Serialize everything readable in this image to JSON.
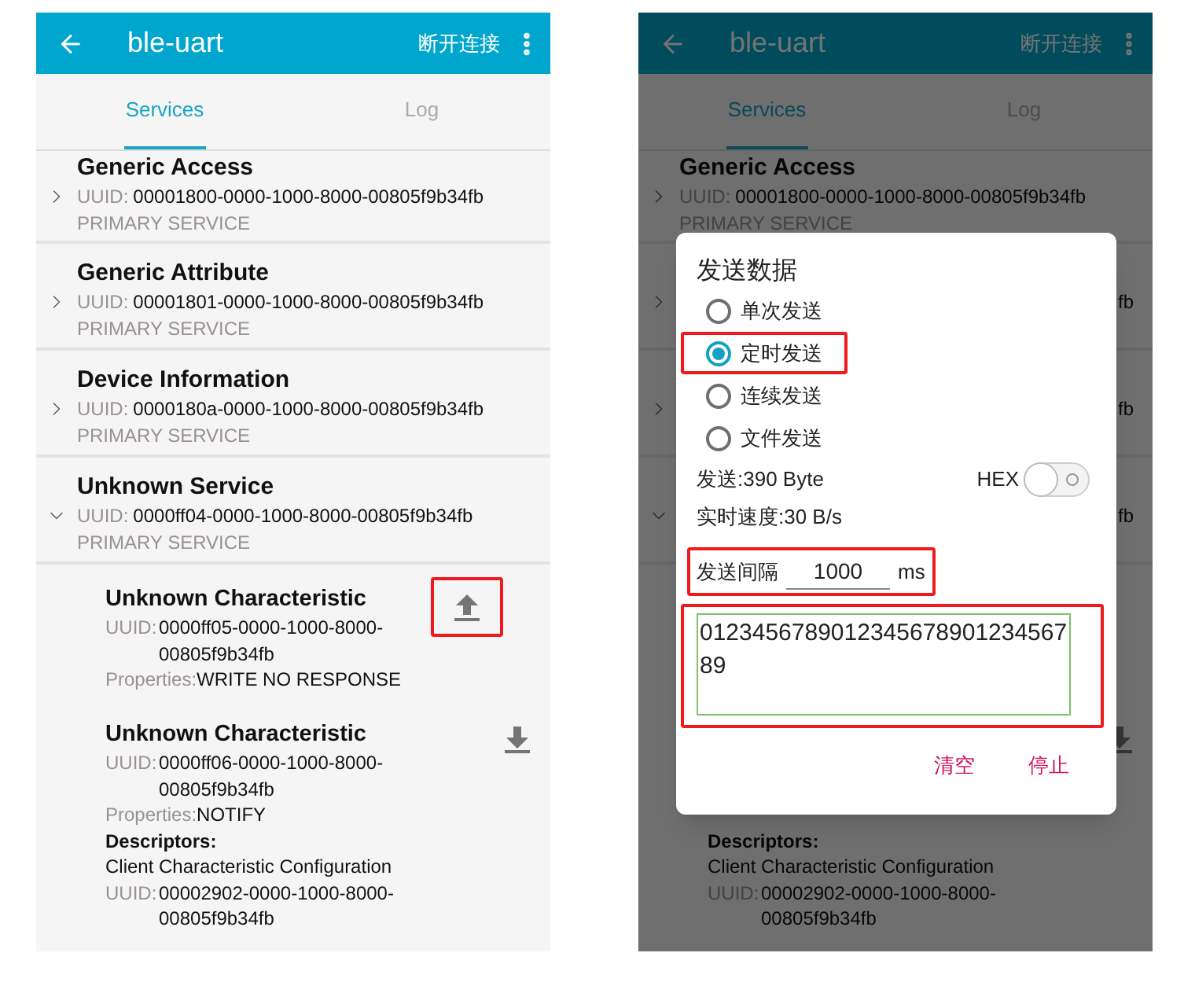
{
  "screens": [
    {
      "kind": "plain",
      "header": {
        "title": "ble-uart",
        "action": "断开连接"
      },
      "tabs": [
        {
          "label": "Services",
          "selected": true
        },
        {
          "label": "Log",
          "selected": false
        }
      ],
      "services": [
        {
          "name": "Generic Access",
          "uuid_label": "UUID:",
          "uuid": "00001800-0000-1000-8000-00805f9b34fb",
          "type": "PRIMARY SERVICE",
          "expanded": false
        },
        {
          "name": "Generic Attribute",
          "uuid_label": "UUID:",
          "uuid": "00001801-0000-1000-8000-00805f9b34fb",
          "type": "PRIMARY SERVICE",
          "expanded": false
        },
        {
          "name": "Device Information",
          "uuid_label": "UUID:",
          "uuid": "0000180a-0000-1000-8000-00805f9b34fb",
          "type": "PRIMARY SERVICE",
          "expanded": false
        },
        {
          "name": "Unknown Service",
          "uuid_label": "UUID:",
          "uuid": "0000ff04-0000-1000-8000-00805f9b34fb",
          "type": "PRIMARY SERVICE",
          "expanded": true
        }
      ],
      "characteristics": [
        {
          "kind": "write",
          "highlighted": true,
          "name": "Unknown Characteristic",
          "uuid_label": "UUID:",
          "uuid_lines": [
            "0000ff05-0000-1000-8000-",
            "00805f9b34fb"
          ],
          "properties_label": "Properties:",
          "properties": "WRITE NO RESPONSE"
        },
        {
          "kind": "notify",
          "highlighted": false,
          "name": "Unknown Characteristic",
          "uuid_label": "UUID:",
          "uuid_lines": [
            "0000ff06-0000-1000-8000-",
            "00805f9b34fb"
          ],
          "properties_label": "Properties:",
          "properties": "NOTIFY",
          "descriptors_title": "Descriptors:",
          "descriptor": {
            "name": "Client Characteristic Configuration",
            "uuid_label": "UUID:",
            "uuid_lines": [
              "00002902-0000-1000-8000-",
              "00805f9b34fb"
            ]
          }
        }
      ]
    },
    {
      "kind": "dialog",
      "header": {
        "title": "ble-uart",
        "action": "断开连接"
      },
      "tabs": [
        {
          "label": "Services",
          "selected": true
        },
        {
          "label": "Log",
          "selected": false
        }
      ],
      "services": [
        {
          "name": "Generic Access",
          "uuid_label": "UUID:",
          "uuid": "00001800-0000-1000-8000-00805f9b34fb",
          "type": "PRIMARY SERVICE",
          "expanded": false
        },
        {
          "uuid_tail": "fb",
          "expanded": false
        },
        {
          "uuid_tail": "fb",
          "expanded": false
        },
        {
          "uuid_tail": "fb",
          "expanded": true
        }
      ],
      "characteristics": [
        {
          "kind": "covered"
        },
        {
          "kind": "notify",
          "highlighted": false,
          "descriptors_title": "Descriptors:",
          "descriptor": {
            "name": "Client Characteristic Configuration",
            "uuid_label": "UUID:",
            "uuid_lines": [
              "00002902-0000-1000-8000-",
              "00805f9b34fb"
            ]
          }
        }
      ],
      "dialog": {
        "title": "发送数据",
        "options": [
          {
            "label": "单次发送",
            "selected": false,
            "highlighted": false
          },
          {
            "label": "定时发送",
            "selected": true,
            "highlighted": true
          },
          {
            "label": "连续发送",
            "selected": false,
            "highlighted": false
          },
          {
            "label": "文件发送",
            "selected": false,
            "highlighted": false
          }
        ],
        "sent": "发送:390 Byte",
        "hex": {
          "label": "HEX",
          "on": false
        },
        "speed": "实时速度:30 B/s",
        "interval": {
          "label": "发送间隔",
          "value": "1000",
          "unit": "ms",
          "highlighted": true
        },
        "data": {
          "value": "012345678901234567890123456789",
          "highlighted": true
        },
        "buttons": [
          "清空",
          "停止"
        ]
      }
    }
  ]
}
